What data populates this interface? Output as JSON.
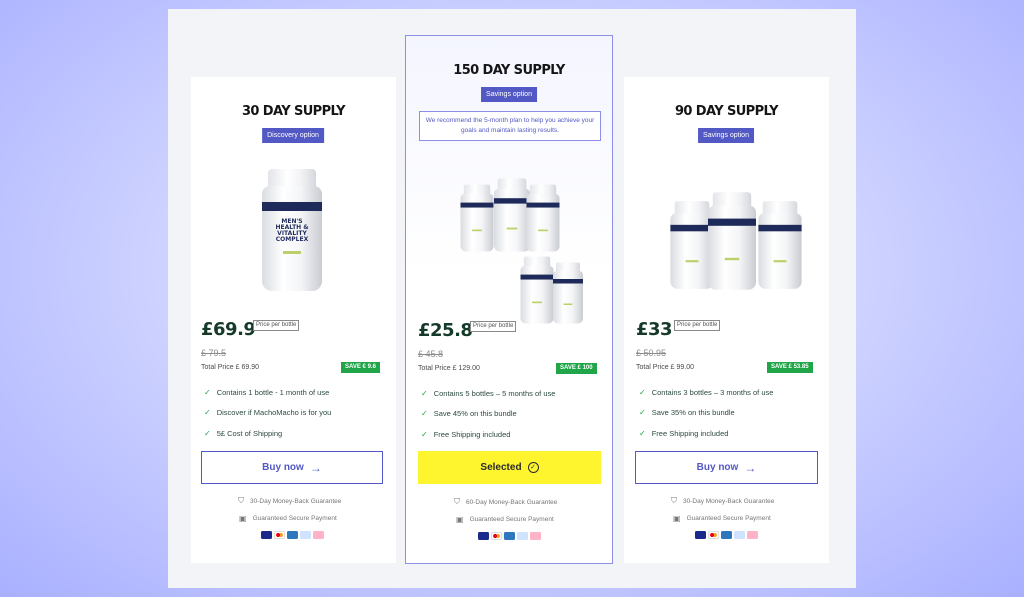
{
  "cards": [
    {
      "title": "30 DAY SUPPLY",
      "tag": "Discovery option",
      "price": "£69.9",
      "price_note": "Price per bottle",
      "old_price": "£ 79.5",
      "total": "Total Price £ 69.90",
      "save": "SAVE € 9.6",
      "features": [
        "Contains 1 bottle - 1 month of use",
        "Discover if MachoMacho is for you",
        "5£ Cost of Shipping"
      ],
      "button": "Buy now",
      "guarantee": "30-Day Money-Back Guarantee",
      "secure": "Guaranteed Secure Payment"
    },
    {
      "title": "150 DAY SUPPLY",
      "tag": "Savings option",
      "note": "We recommend the 5-month plan to help you achieve your goals and maintain lasting results.",
      "price": "£25.8",
      "price_note": "Price per bottle",
      "old_price": "£ 45.8",
      "total": "Total Price £ 129.00",
      "save": "SAVE £ 100",
      "features": [
        "Contains 5 bottles – 5 months of use",
        "Save 45% on this bundle",
        "Free Shipping included"
      ],
      "button": "Selected",
      "guarantee": "60-Day Money-Back Guarantee",
      "secure": "Guaranteed Secure Payment"
    },
    {
      "title": "90 DAY SUPPLY",
      "tag": "Savings option",
      "price": "£33",
      "price_note": "Price per bottle",
      "old_price": "£ 50.95",
      "total": "Total Price £ 99.00",
      "save": "SAVE £ 53.85",
      "features": [
        "Contains 3 bottles – 3 months of use",
        "Save 35% on this bundle",
        "Free Shipping included"
      ],
      "button": "Buy now",
      "guarantee": "30-Day Money-Back Guarantee",
      "secure": "Guaranteed Secure Payment"
    }
  ],
  "product": {
    "brand": "MachoMacho",
    "label": "MEN'S HEALTH & VITALITY COMPLEX"
  },
  "payment_methods": [
    "visa",
    "mastercard",
    "amex",
    "paypal",
    "klarna"
  ],
  "colors": {
    "accent": "#5359c4",
    "selected": "#fff52f",
    "save": "#20a549",
    "price": "#163a2a"
  }
}
